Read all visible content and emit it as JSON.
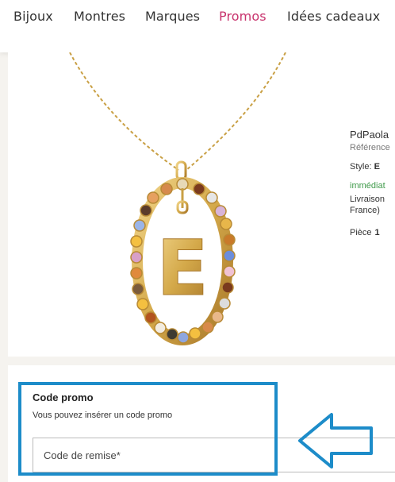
{
  "nav": {
    "items": [
      "Bijoux",
      "Montres",
      "Marques",
      "Promos",
      "Idées cadeaux"
    ]
  },
  "product": {
    "brand": "PdPaola",
    "reference": "Référence",
    "style_label": "Style:",
    "style_value": "E",
    "stock": "immédiat",
    "delivery_line1": "Livraison",
    "delivery_line2": "France)",
    "qty_label": "Pièce",
    "qty_value": "1",
    "pendant_letter": "E"
  },
  "promo": {
    "title": "Code promo",
    "subtitle": "Vous pouvez insérer un code promo",
    "placeholder": "Code de remise*"
  },
  "colors": {
    "accent_pink": "#c8336d",
    "highlight_blue": "#1d8cc9",
    "stock_green": "#3f9a4a",
    "gold": "#d4a94a"
  }
}
